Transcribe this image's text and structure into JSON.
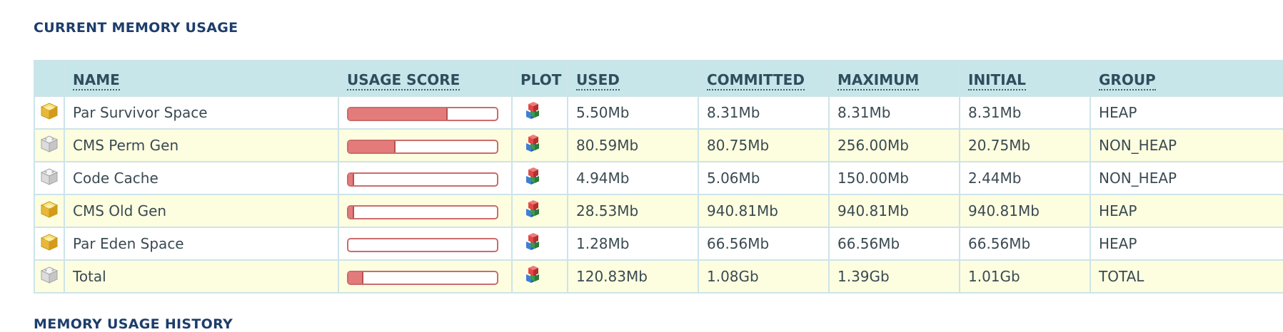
{
  "section_title": "CURRENT MEMORY USAGE",
  "next_section_title": "MEMORY USAGE HISTORY",
  "columns": {
    "name": "NAME",
    "usage_score": "USAGE SCORE",
    "plot": "PLOT",
    "used": "USED",
    "committed": "COMMITTED",
    "maximum": "MAXIMUM",
    "initial": "INITIAL",
    "group": "GROUP"
  },
  "colors": {
    "bar_fill": "#e47b7b",
    "bar_border": "#cc6b6b",
    "header_bg": "#c7e6ea",
    "row_alt_bg": "#fdfde0",
    "title": "#1d3d6b"
  },
  "rows": [
    {
      "icon": "heap-pool-icon",
      "name": "Par Survivor Space",
      "usage_fraction": 0.66,
      "used": "5.50Mb",
      "committed": "8.31Mb",
      "maximum": "8.31Mb",
      "initial": "8.31Mb",
      "group": "HEAP"
    },
    {
      "icon": "non-heap-pool-icon",
      "name": "CMS Perm Gen",
      "usage_fraction": 0.31,
      "used": "80.59Mb",
      "committed": "80.75Mb",
      "maximum": "256.00Mb",
      "initial": "20.75Mb",
      "group": "NON_HEAP"
    },
    {
      "icon": "non-heap-pool-icon",
      "name": "Code Cache",
      "usage_fraction": 0.03,
      "used": "4.94Mb",
      "committed": "5.06Mb",
      "maximum": "150.00Mb",
      "initial": "2.44Mb",
      "group": "NON_HEAP"
    },
    {
      "icon": "heap-pool-icon",
      "name": "CMS Old Gen",
      "usage_fraction": 0.03,
      "used": "28.53Mb",
      "committed": "940.81Mb",
      "maximum": "940.81Mb",
      "initial": "940.81Mb",
      "group": "HEAP"
    },
    {
      "icon": "heap-pool-icon",
      "name": "Par Eden Space",
      "usage_fraction": 0.0,
      "used": "1.28Mb",
      "committed": "66.56Mb",
      "maximum": "66.56Mb",
      "initial": "66.56Mb",
      "group": "HEAP"
    },
    {
      "icon": "non-heap-pool-icon",
      "name": "Total",
      "usage_fraction": 0.09,
      "used": "120.83Mb",
      "committed": "1.08Gb",
      "maximum": "1.39Gb",
      "initial": "1.01Gb",
      "group": "TOTAL"
    }
  ]
}
